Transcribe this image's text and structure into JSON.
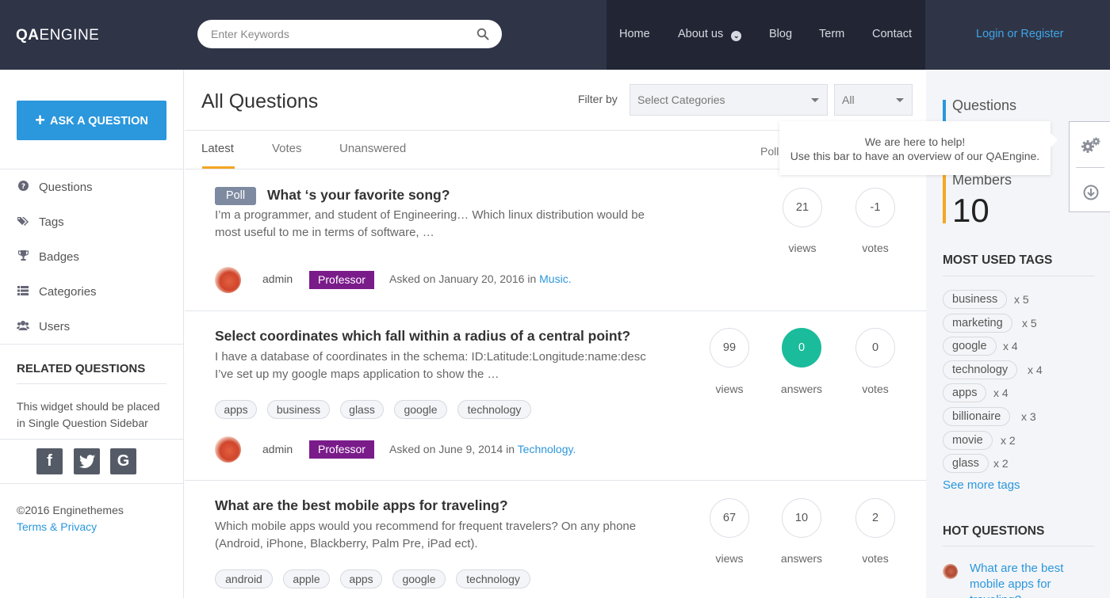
{
  "header": {
    "logo_bold": "QA",
    "logo_rest": "ENGINE",
    "search_placeholder": "Enter Keywords",
    "nav": [
      "Home",
      "About us",
      "Blog",
      "Term",
      "Contact"
    ],
    "login": "Login or Register"
  },
  "left": {
    "ask_button": "ASK A QUESTION",
    "menu": [
      "Questions",
      "Tags",
      "Badges",
      "Categories",
      "Users"
    ],
    "related_title": "RELATED QUESTIONS",
    "widget_text": "This widget should be placed in Single Question Sidebar",
    "social": [
      "f",
      "t",
      "G"
    ],
    "copyright": "©2016 Enginethemes",
    "terms": "Terms & Privacy"
  },
  "main": {
    "title": "All Questions",
    "filter_label": "Filter by",
    "select_categories": "Select Categories",
    "select_all": "All",
    "tabs": [
      "Latest",
      "Votes",
      "Unanswered"
    ],
    "polls_tab": "Polls",
    "questions": [
      {
        "poll_badge": "Poll",
        "title": "What ‘s your favorite song?",
        "excerpt": "I’m a programmer, and student of Engineering… Which linux distribution would be most useful to me in terms of software, …",
        "author": "admin",
        "badge": "Professor",
        "asked_prefix": "Asked on January 20, 2016 in",
        "category": "Music.",
        "tags": [],
        "stats": [
          {
            "value": "21",
            "label": "views"
          },
          {
            "value": "-1",
            "label": "votes"
          }
        ]
      },
      {
        "title": "Select coordinates which fall within a radius of a central point?",
        "excerpt": "I have a database of coordinates in the schema: ID:Latitude:Longitude:name:desc I’ve set up my google maps application to show the …",
        "author": "admin",
        "badge": "Professor",
        "asked_prefix": "Asked on June 9, 2014 in",
        "category": "Technology.",
        "tags": [
          "apps",
          "business",
          "glass",
          "google",
          "technology"
        ],
        "stats": [
          {
            "value": "99",
            "label": "views"
          },
          {
            "value": "0",
            "label": "answers"
          },
          {
            "value": "0",
            "label": "votes"
          }
        ]
      },
      {
        "title": "What are the best mobile apps for traveling?",
        "excerpt": "Which mobile apps would you recommend for frequent travelers? On any phone (Android, iPhone, Blackberry, Palm Pre, iPad ect).",
        "tags": [
          "android",
          "apple",
          "apps",
          "google",
          "technology"
        ],
        "stats": [
          {
            "value": "67",
            "label": "views"
          },
          {
            "value": "10",
            "label": "answers"
          },
          {
            "value": "2",
            "label": "votes"
          }
        ]
      }
    ]
  },
  "right": {
    "questions_label": "Questions",
    "members_label": "Members",
    "members_value": "10",
    "tooltip_line1": "We are here to help!",
    "tooltip_line2": "Use this bar to have an overview of our QAEngine.",
    "most_used_title": "MOST USED TAGS",
    "tags": [
      {
        "name": "business",
        "count": "x 5"
      },
      {
        "name": "marketing",
        "count": "x 5"
      },
      {
        "name": "google",
        "count": "x 4"
      },
      {
        "name": "technology",
        "count": "x 4"
      },
      {
        "name": "apps",
        "count": "x 4"
      },
      {
        "name": "billionaire",
        "count": "x 3"
      },
      {
        "name": "movie",
        "count": "x 2"
      },
      {
        "name": "glass",
        "count": "x 2"
      }
    ],
    "see_more": "See more tags",
    "hot_title": "HOT QUESTIONS",
    "hot_question": "What are the best mobile apps for traveling?"
  },
  "colors": {
    "header_bg": "#2f3547",
    "nav_bg": "#222634",
    "accent_blue": "#2b97dc",
    "answer_green": "#1bbc9b",
    "badge_purple": "#7a1b8a",
    "tab_orange": "#f5a623"
  }
}
